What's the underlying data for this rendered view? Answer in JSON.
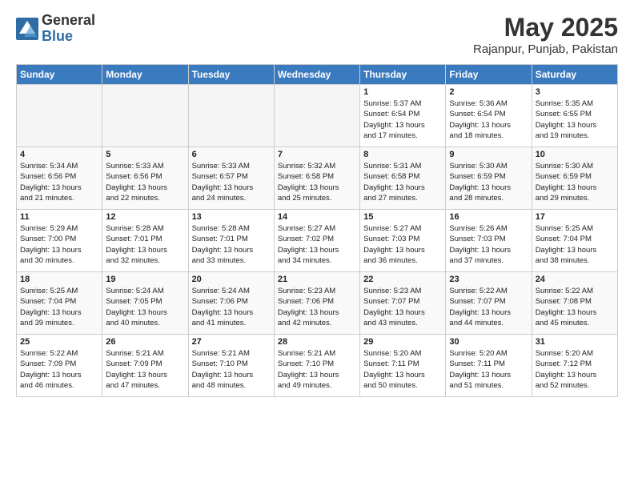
{
  "logo": {
    "general": "General",
    "blue": "Blue"
  },
  "title": "May 2025",
  "subtitle": "Rajanpur, Punjab, Pakistan",
  "days_of_week": [
    "Sunday",
    "Monday",
    "Tuesday",
    "Wednesday",
    "Thursday",
    "Friday",
    "Saturday"
  ],
  "weeks": [
    [
      {
        "day": "",
        "info": ""
      },
      {
        "day": "",
        "info": ""
      },
      {
        "day": "",
        "info": ""
      },
      {
        "day": "",
        "info": ""
      },
      {
        "day": "1",
        "info": "Sunrise: 5:37 AM\nSunset: 6:54 PM\nDaylight: 13 hours\nand 17 minutes."
      },
      {
        "day": "2",
        "info": "Sunrise: 5:36 AM\nSunset: 6:54 PM\nDaylight: 13 hours\nand 18 minutes."
      },
      {
        "day": "3",
        "info": "Sunrise: 5:35 AM\nSunset: 6:55 PM\nDaylight: 13 hours\nand 19 minutes."
      }
    ],
    [
      {
        "day": "4",
        "info": "Sunrise: 5:34 AM\nSunset: 6:56 PM\nDaylight: 13 hours\nand 21 minutes."
      },
      {
        "day": "5",
        "info": "Sunrise: 5:33 AM\nSunset: 6:56 PM\nDaylight: 13 hours\nand 22 minutes."
      },
      {
        "day": "6",
        "info": "Sunrise: 5:33 AM\nSunset: 6:57 PM\nDaylight: 13 hours\nand 24 minutes."
      },
      {
        "day": "7",
        "info": "Sunrise: 5:32 AM\nSunset: 6:58 PM\nDaylight: 13 hours\nand 25 minutes."
      },
      {
        "day": "8",
        "info": "Sunrise: 5:31 AM\nSunset: 6:58 PM\nDaylight: 13 hours\nand 27 minutes."
      },
      {
        "day": "9",
        "info": "Sunrise: 5:30 AM\nSunset: 6:59 PM\nDaylight: 13 hours\nand 28 minutes."
      },
      {
        "day": "10",
        "info": "Sunrise: 5:30 AM\nSunset: 6:59 PM\nDaylight: 13 hours\nand 29 minutes."
      }
    ],
    [
      {
        "day": "11",
        "info": "Sunrise: 5:29 AM\nSunset: 7:00 PM\nDaylight: 13 hours\nand 30 minutes."
      },
      {
        "day": "12",
        "info": "Sunrise: 5:28 AM\nSunset: 7:01 PM\nDaylight: 13 hours\nand 32 minutes."
      },
      {
        "day": "13",
        "info": "Sunrise: 5:28 AM\nSunset: 7:01 PM\nDaylight: 13 hours\nand 33 minutes."
      },
      {
        "day": "14",
        "info": "Sunrise: 5:27 AM\nSunset: 7:02 PM\nDaylight: 13 hours\nand 34 minutes."
      },
      {
        "day": "15",
        "info": "Sunrise: 5:27 AM\nSunset: 7:03 PM\nDaylight: 13 hours\nand 36 minutes."
      },
      {
        "day": "16",
        "info": "Sunrise: 5:26 AM\nSunset: 7:03 PM\nDaylight: 13 hours\nand 37 minutes."
      },
      {
        "day": "17",
        "info": "Sunrise: 5:25 AM\nSunset: 7:04 PM\nDaylight: 13 hours\nand 38 minutes."
      }
    ],
    [
      {
        "day": "18",
        "info": "Sunrise: 5:25 AM\nSunset: 7:04 PM\nDaylight: 13 hours\nand 39 minutes."
      },
      {
        "day": "19",
        "info": "Sunrise: 5:24 AM\nSunset: 7:05 PM\nDaylight: 13 hours\nand 40 minutes."
      },
      {
        "day": "20",
        "info": "Sunrise: 5:24 AM\nSunset: 7:06 PM\nDaylight: 13 hours\nand 41 minutes."
      },
      {
        "day": "21",
        "info": "Sunrise: 5:23 AM\nSunset: 7:06 PM\nDaylight: 13 hours\nand 42 minutes."
      },
      {
        "day": "22",
        "info": "Sunrise: 5:23 AM\nSunset: 7:07 PM\nDaylight: 13 hours\nand 43 minutes."
      },
      {
        "day": "23",
        "info": "Sunrise: 5:22 AM\nSunset: 7:07 PM\nDaylight: 13 hours\nand 44 minutes."
      },
      {
        "day": "24",
        "info": "Sunrise: 5:22 AM\nSunset: 7:08 PM\nDaylight: 13 hours\nand 45 minutes."
      }
    ],
    [
      {
        "day": "25",
        "info": "Sunrise: 5:22 AM\nSunset: 7:09 PM\nDaylight: 13 hours\nand 46 minutes."
      },
      {
        "day": "26",
        "info": "Sunrise: 5:21 AM\nSunset: 7:09 PM\nDaylight: 13 hours\nand 47 minutes."
      },
      {
        "day": "27",
        "info": "Sunrise: 5:21 AM\nSunset: 7:10 PM\nDaylight: 13 hours\nand 48 minutes."
      },
      {
        "day": "28",
        "info": "Sunrise: 5:21 AM\nSunset: 7:10 PM\nDaylight: 13 hours\nand 49 minutes."
      },
      {
        "day": "29",
        "info": "Sunrise: 5:20 AM\nSunset: 7:11 PM\nDaylight: 13 hours\nand 50 minutes."
      },
      {
        "day": "30",
        "info": "Sunrise: 5:20 AM\nSunset: 7:11 PM\nDaylight: 13 hours\nand 51 minutes."
      },
      {
        "day": "31",
        "info": "Sunrise: 5:20 AM\nSunset: 7:12 PM\nDaylight: 13 hours\nand 52 minutes."
      }
    ]
  ]
}
